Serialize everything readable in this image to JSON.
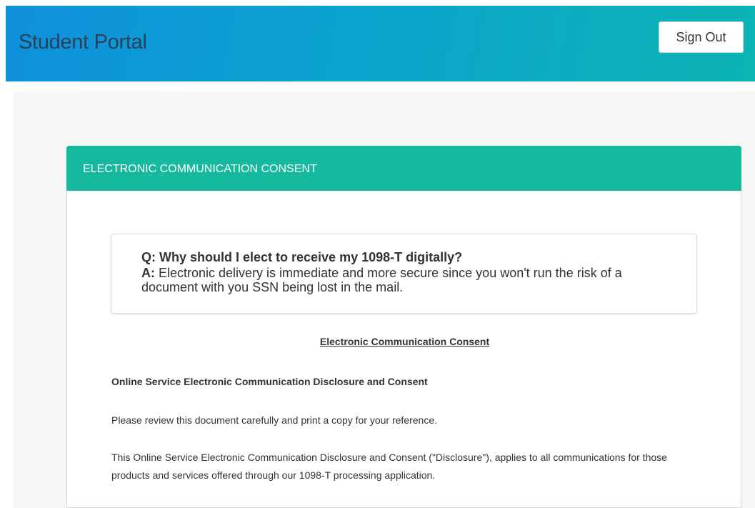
{
  "header": {
    "app_title": "Student Portal",
    "sign_out_label": "Sign Out"
  },
  "panel": {
    "title": "ELECTRONIC COMMUNICATION CONSENT",
    "faq": {
      "question": "Q: Why should I elect to receive my 1098-T digitally?",
      "answer_prefix": "A:",
      "answer_text": " Electronic delivery is immediate and more secure since you won't run the risk of a document with you SSN being lost in the mail."
    },
    "document": {
      "heading": "Electronic Communication Consent",
      "subheading": "Online Service Electronic Communication Disclosure and Consent",
      "paragraph_1": "Please review this document carefully and print a copy for your reference.",
      "paragraph_2": "This Online Service Electronic Communication Disclosure and Consent (\"Disclosure\"), applies to all communications for those products and services offered through our 1098-T processing application."
    }
  },
  "colors": {
    "header_gradient_start": "#0f90db",
    "header_gradient_end": "#0cb4b4",
    "panel_header": "#14b99e",
    "content_background": "#f6f6f6"
  }
}
